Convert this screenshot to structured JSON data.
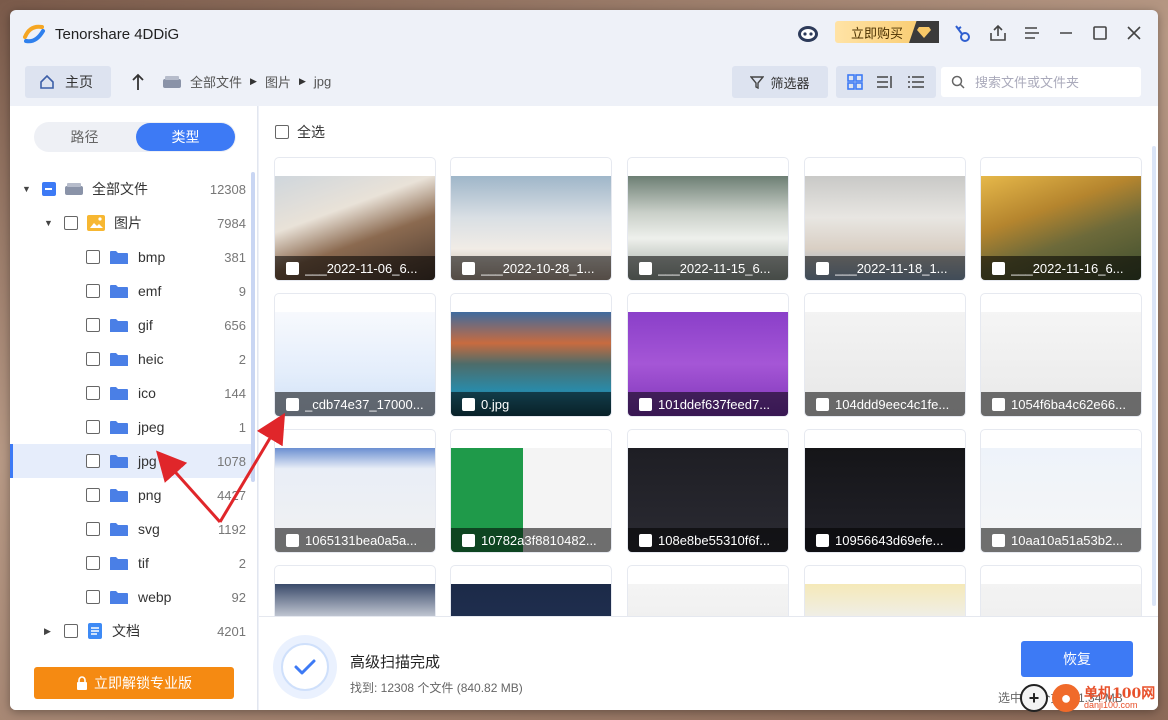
{
  "app": {
    "title": "Tenorshare 4DDiG",
    "buy_label": "立即购买"
  },
  "nav": {
    "home_label": "主页",
    "breadcrumb": [
      "全部文件",
      "图片",
      "jpg"
    ],
    "filter_label": "筛选器",
    "search_placeholder": "搜索文件或文件夹"
  },
  "sidebar": {
    "tab_path": "路径",
    "tab_type": "类型",
    "root": {
      "label": "全部文件",
      "count": "12308"
    },
    "images": {
      "label": "图片",
      "count": "7984"
    },
    "subtypes": [
      {
        "label": "bmp",
        "count": "381"
      },
      {
        "label": "emf",
        "count": "9"
      },
      {
        "label": "gif",
        "count": "656"
      },
      {
        "label": "heic",
        "count": "2"
      },
      {
        "label": "ico",
        "count": "144"
      },
      {
        "label": "jpeg",
        "count": "1"
      },
      {
        "label": "jpg",
        "count": "1078"
      },
      {
        "label": "png",
        "count": "4427"
      },
      {
        "label": "svg",
        "count": "1192"
      },
      {
        "label": "tif",
        "count": "2"
      },
      {
        "label": "webp",
        "count": "92"
      }
    ],
    "docs": {
      "label": "文档",
      "count": "4201"
    },
    "unlock_label": "立即解锁专业版"
  },
  "content": {
    "select_all": "全选",
    "files": [
      "___2022-11-06_6...",
      "___2022-10-28_1...",
      "___2022-11-15_6...",
      "___2022-11-18_1...",
      "___2022-11-16_6...",
      "_cdb74e37_17000...",
      "0.jpg",
      "101ddef637feed7...",
      "104ddd9eec4c1fe...",
      "1054f6ba4c62e66...",
      "1065131bea0a5a...",
      "10782a3f8810482...",
      "108e8be55310f6f...",
      "10956643d69efe...",
      "10aa10a51a53b2..."
    ]
  },
  "status": {
    "title": "高级扫描完成",
    "found": "找到: 12308 个文件 (840.82 MB)",
    "recover_label": "恢复",
    "selected": "选中: 1 个文件  1.34 MB"
  },
  "watermark": {
    "name": "单机100网",
    "url": "danji100.com"
  }
}
